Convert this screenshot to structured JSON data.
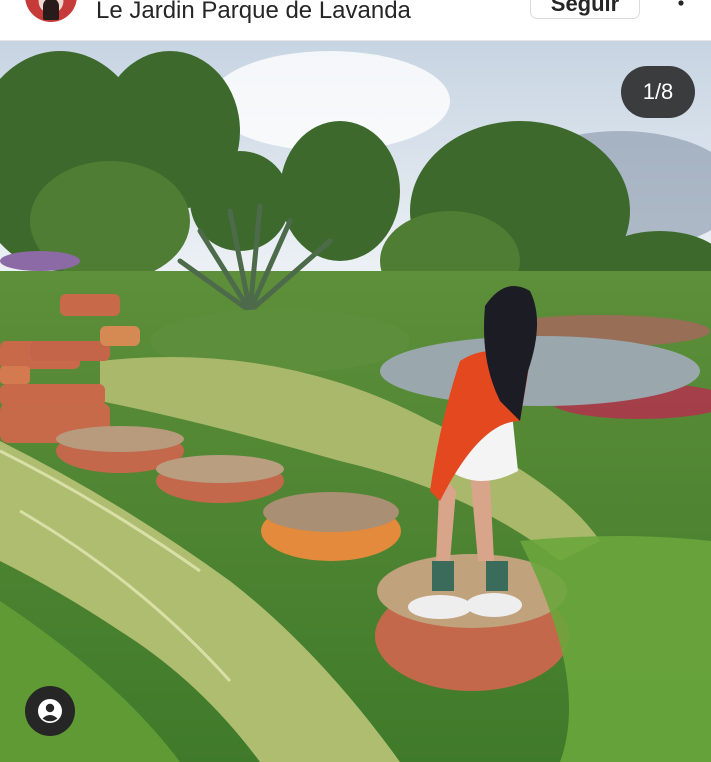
{
  "header": {
    "account_name": "Le Jardin Parque de Lavanda",
    "follow_label": "Seguir",
    "more_icon": "more-dots-icon",
    "avatar_icon": "profile-avatar"
  },
  "post": {
    "carousel_counter": "1/8",
    "tag_icon": "user-tag-icon"
  },
  "colors": {
    "text": "#262626",
    "border": "#dbdbdb",
    "overlay": "#262626"
  }
}
